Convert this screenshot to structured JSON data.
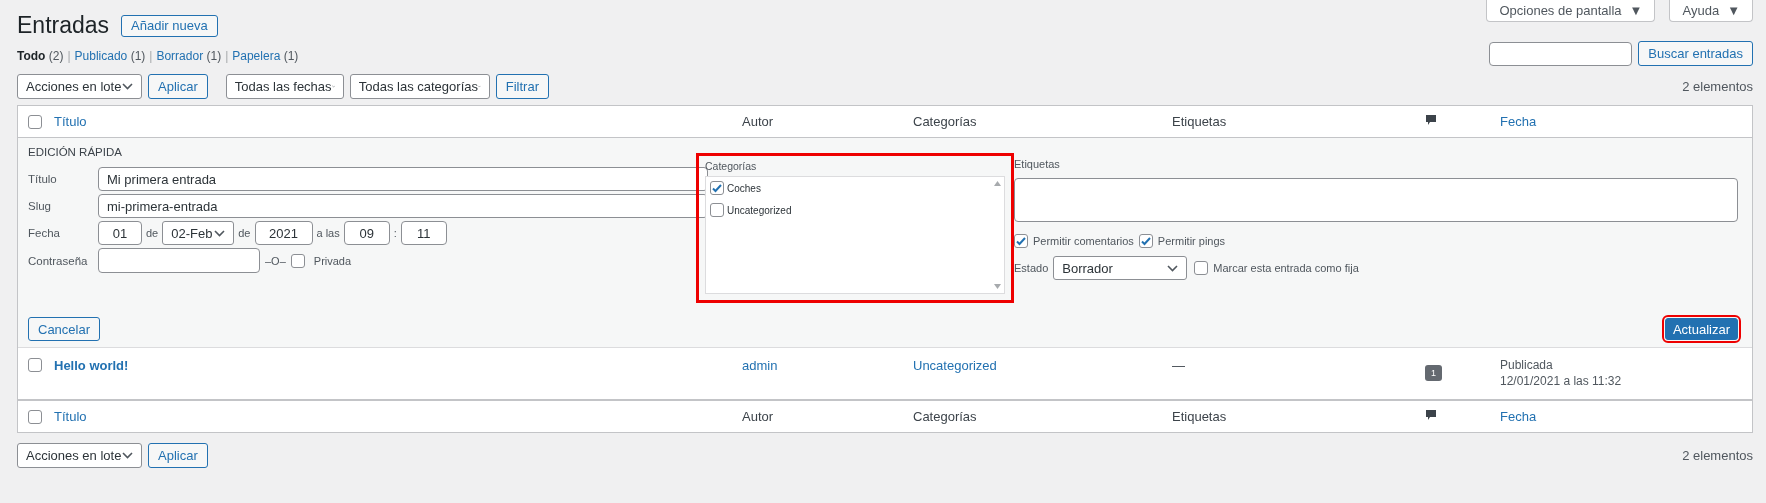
{
  "page": {
    "title": "Entradas",
    "add_new": "Añadir nueva"
  },
  "screen_options": [
    {
      "label": "Opciones de pantalla",
      "caret": "▼"
    },
    {
      "label": "Ayuda",
      "caret": "▼"
    }
  ],
  "status_links": [
    {
      "label": "Todo",
      "count": "(2)",
      "selected": true
    },
    {
      "separator": "|",
      "label": "Publicado",
      "count": "(1)",
      "selected": false
    },
    {
      "separator": "|",
      "label": "Borrador",
      "count": "(1)",
      "selected": false
    },
    {
      "separator": "|",
      "label": "Papelera",
      "count": "(1)",
      "selected": false
    }
  ],
  "search": {
    "button": "Buscar entradas"
  },
  "top_filters": {
    "bulk_action": "Acciones en lote",
    "apply": "Aplicar",
    "dates": "Todas las fechas",
    "categories": "Todas las categorías",
    "filter": "Filtrar",
    "item_count": "2 elementos"
  },
  "table": {
    "select_all_checked": false,
    "columns": [
      {
        "kind": "link",
        "label": "Título"
      },
      {
        "kind": "text",
        "label": "Autor"
      },
      {
        "kind": "text",
        "label": "Categorías"
      },
      {
        "kind": "text",
        "label": "Etiquetas"
      },
      {
        "kind": "comments"
      },
      {
        "kind": "link",
        "label": "Fecha"
      }
    ],
    "footer_select_all_checked": false,
    "footer_columns": [
      {
        "kind": "link",
        "label": "Título"
      },
      {
        "kind": "text",
        "label": "Autor"
      },
      {
        "kind": "text",
        "label": "Categorías"
      },
      {
        "kind": "text",
        "label": "Etiquetas"
      },
      {
        "kind": "comments"
      },
      {
        "kind": "link",
        "label": "Fecha"
      }
    ],
    "quick_edit": {
      "heading": "EDICIÓN RÁPIDA",
      "title_label": "Título",
      "title_value": "Mi primera entrada",
      "slug_label": "Slug",
      "slug_value": "mi-primera-entrada",
      "date_label": "Fecha",
      "day": "01",
      "de1": "de",
      "month": "02-Feb",
      "de2": "de",
      "year": "2021",
      "a_las": "a las",
      "hour": "09",
      "colon": ":",
      "minute": "11",
      "password_label": "Contraseña",
      "or": "–O–",
      "private_label": "Privada",
      "private_checked": false,
      "categories_label": "Categorías",
      "categories_highlighted": true,
      "categories": [
        {
          "name": "Coches",
          "checked": true
        },
        {
          "name": "Uncategorized",
          "checked": false
        }
      ],
      "tags_label": "Etiquetas",
      "allow_comments": {
        "label": "Permitir comentarios",
        "checked": true
      },
      "allow_pings": {
        "label": "Permitir pings",
        "checked": true
      },
      "status_label": "Estado",
      "status_value": "Borrador",
      "sticky": {
        "label": "Marcar esta entrada como fija",
        "checked": false
      },
      "cancel": "Cancelar",
      "update": "Actualizar",
      "update_highlighted": true
    },
    "rows": [
      {
        "checked": false,
        "title": "Hello world!",
        "author": "admin",
        "categories": "Uncategorized",
        "tags": "—",
        "comments": "1",
        "status": "Publicada",
        "date": "12/01/2021 a las 11:32"
      }
    ]
  },
  "bottom": {
    "bulk_action": "Acciones en lote",
    "apply": "Aplicar",
    "item_count": "2 elementos"
  }
}
